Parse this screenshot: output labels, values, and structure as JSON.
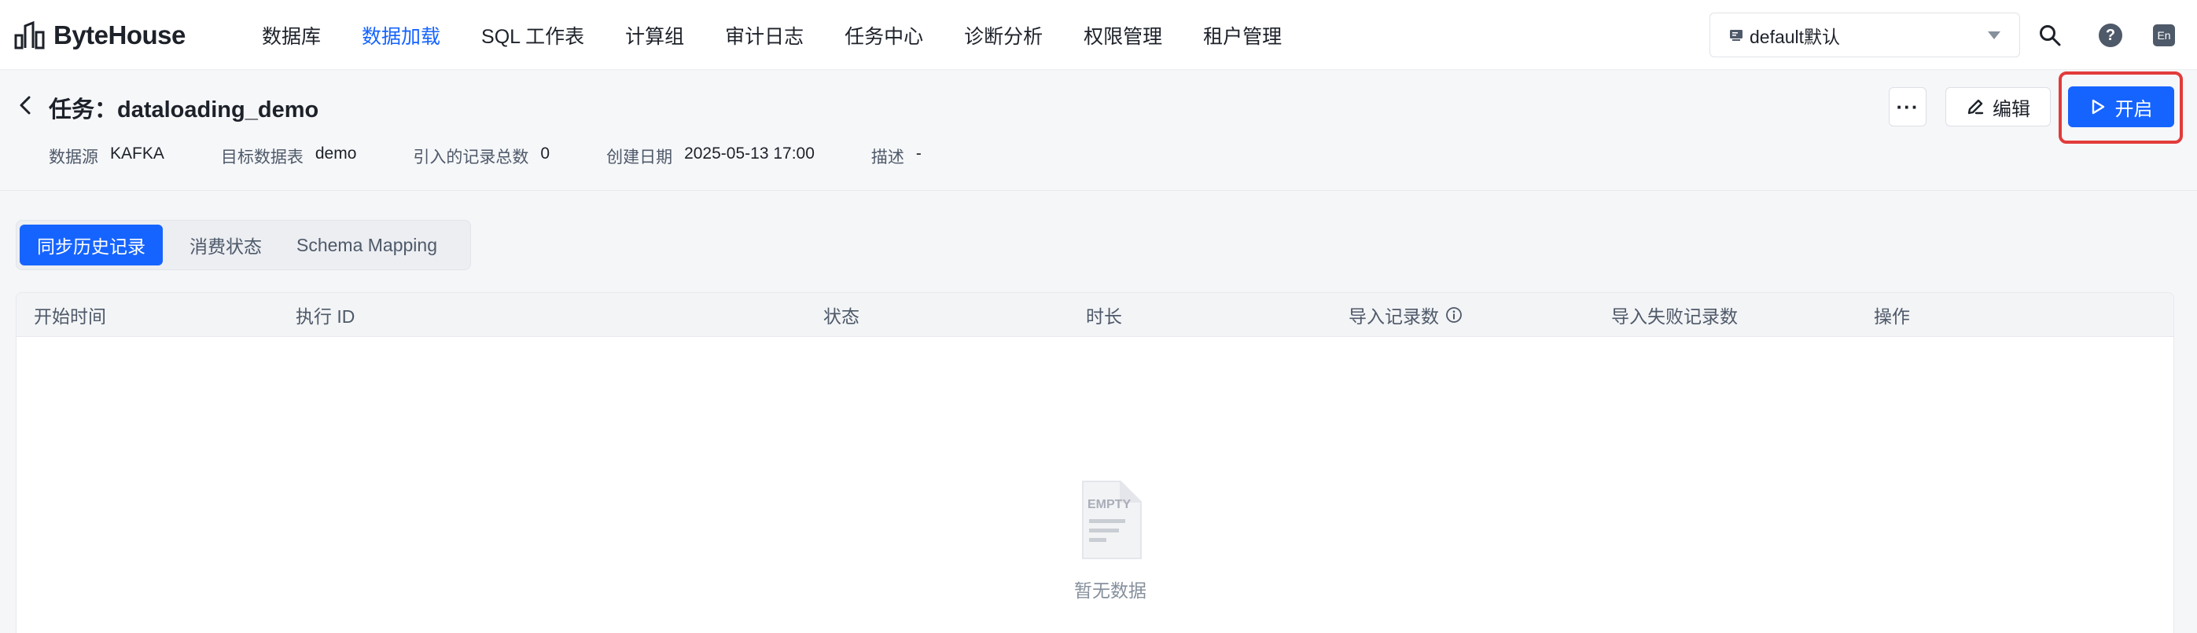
{
  "app": {
    "brand": "ByteHouse"
  },
  "nav": {
    "items": [
      {
        "label": "数据库",
        "active": false
      },
      {
        "label": "数据加载",
        "active": true
      },
      {
        "label": "SQL 工作表",
        "active": false
      },
      {
        "label": "计算组",
        "active": false
      },
      {
        "label": "审计日志",
        "active": false
      },
      {
        "label": "任务中心",
        "active": false
      },
      {
        "label": "诊断分析",
        "active": false
      },
      {
        "label": "权限管理",
        "active": false
      },
      {
        "label": "租户管理",
        "active": false
      }
    ],
    "tenant_select": {
      "value": "default默认"
    },
    "lang_label": "En",
    "help_label": "?"
  },
  "task": {
    "title": "任务：dataloading_demo",
    "meta": [
      {
        "key": "数据源",
        "value": "KAFKA"
      },
      {
        "key": "目标数据表",
        "value": "demo"
      },
      {
        "key": "引入的记录总数",
        "value": "0"
      },
      {
        "key": "创建日期",
        "value": "2025-05-13 17:00"
      },
      {
        "key": "描述",
        "value": "-"
      }
    ],
    "actions": {
      "more_label": "···",
      "edit_label": "编辑",
      "start_label": "开启"
    }
  },
  "tabs": [
    {
      "label": "同步历史记录",
      "active": true
    },
    {
      "label": "消费状态",
      "active": false
    },
    {
      "label": "Schema Mapping",
      "active": false
    }
  ],
  "table": {
    "columns": [
      "开始时间",
      "执行 ID",
      "状态",
      "时长",
      "导入记录数",
      "导入失败记录数",
      "操作"
    ],
    "rows": [],
    "empty_text": "暂无数据",
    "empty_image_label": "EMPTY"
  },
  "colors": {
    "accent": "#1664ff",
    "highlight": "#e23b3b"
  }
}
